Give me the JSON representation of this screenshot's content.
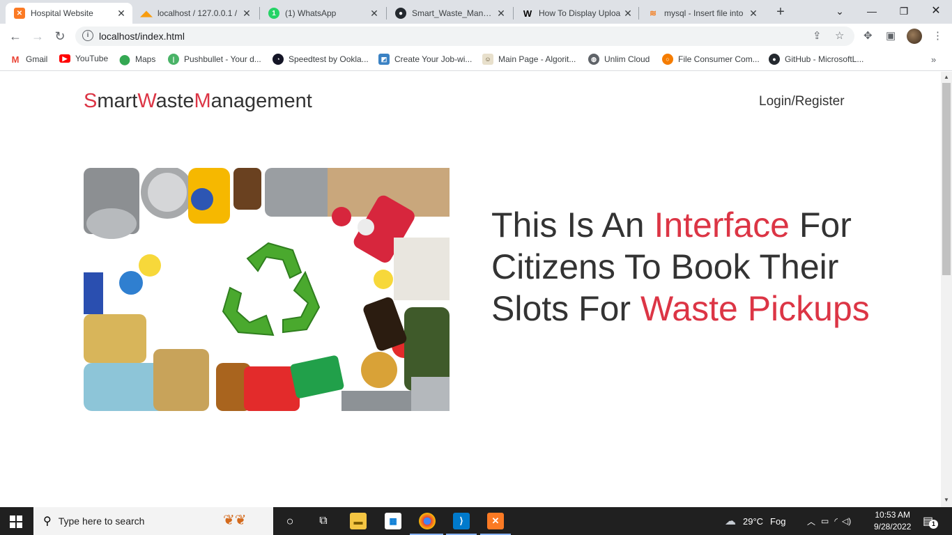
{
  "browser": {
    "tabs": [
      {
        "title": "Hospital Website",
        "favicon": "xampp-icon",
        "active": true
      },
      {
        "title": "localhost / 127.0.0.1 / ",
        "favicon": "phpmyadmin-icon"
      },
      {
        "title": "(1) WhatsApp",
        "favicon": "whatsapp-icon"
      },
      {
        "title": "Smart_Waste_Manage",
        "favicon": "github-icon"
      },
      {
        "title": "How To Display Uploa",
        "favicon": "w-icon"
      },
      {
        "title": "mysql - Insert file into",
        "favicon": "stackoverflow-icon"
      }
    ],
    "new_tab_label": "+",
    "url": "localhost/index.html",
    "bookmarks": [
      {
        "label": "Gmail",
        "icon": "gmail-icon"
      },
      {
        "label": "YouTube",
        "icon": "youtube-icon"
      },
      {
        "label": "Maps",
        "icon": "maps-icon"
      },
      {
        "label": "Pushbullet - Your d...",
        "icon": "pushbullet-icon"
      },
      {
        "label": "Speedtest by Ookla...",
        "icon": "speedtest-icon"
      },
      {
        "label": "Create Your Job-wi...",
        "icon": "job-icon"
      },
      {
        "label": "Main Page - Algorit...",
        "icon": "algorithm-icon"
      },
      {
        "label": "Unlim Cloud",
        "icon": "globe-icon"
      },
      {
        "label": "File Consumer Com...",
        "icon": "file-icon"
      },
      {
        "label": "GitHub - MicrosoftL...",
        "icon": "github-icon"
      }
    ]
  },
  "site": {
    "brand": {
      "s": "S",
      "mart": "mart",
      "w": "W",
      "aste": "aste",
      "m": "M",
      "anagement": "anagement"
    },
    "login_label": "Login/Register",
    "hero": {
      "part1": "This Is An ",
      "highlight1": "Interface",
      "part2": " For Citizens To Book Their Slots For ",
      "highlight2": "Waste Pickups"
    },
    "colors": {
      "accent": "#dc3545",
      "text": "#333333"
    }
  },
  "taskbar": {
    "search_placeholder": "Type here to search",
    "weather_temp": "29°C",
    "weather_text": "Fog",
    "time": "10:53 AM",
    "date": "9/28/2022",
    "notification_count": "1"
  }
}
